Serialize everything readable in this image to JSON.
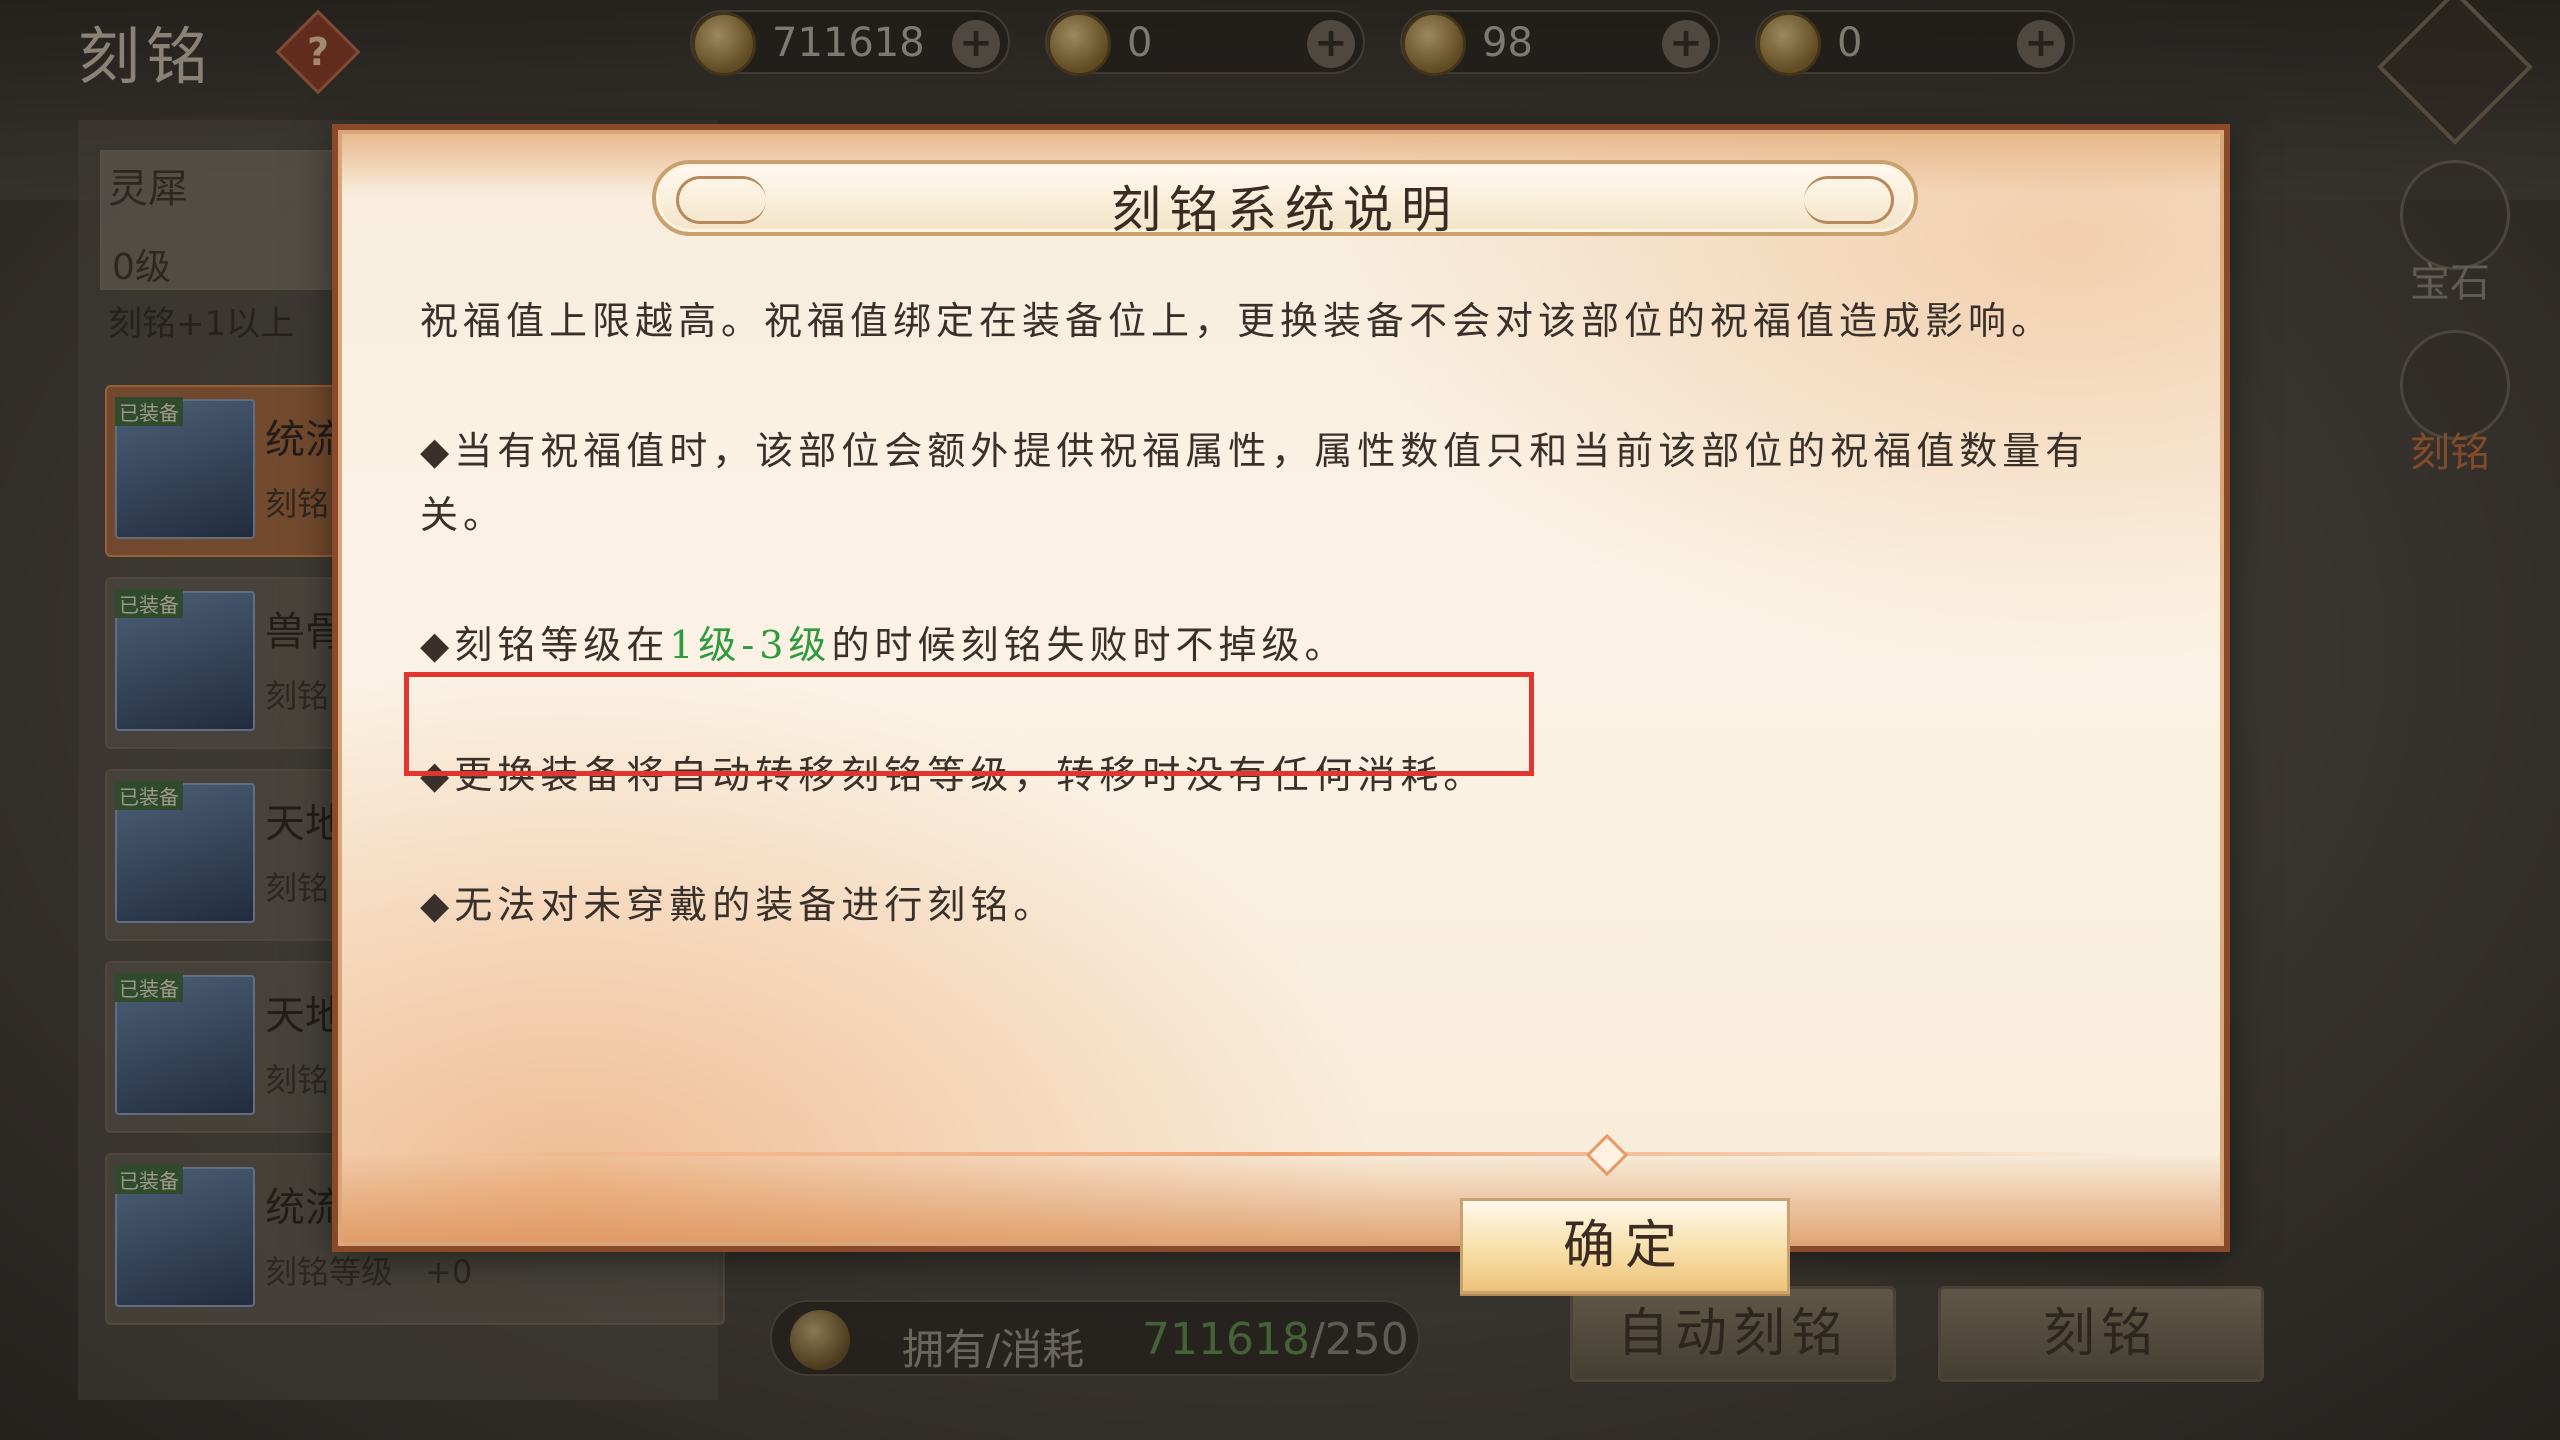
{
  "page": {
    "title": "刻铭",
    "help": "?"
  },
  "currencies": [
    {
      "amount": "711618"
    },
    {
      "amount": "0"
    },
    {
      "amount": "98"
    },
    {
      "amount": "0"
    }
  ],
  "rank": {
    "name": "灵犀",
    "level": "0级",
    "hint": "刻铭+1以上"
  },
  "equipment": [
    {
      "tag": "已装备",
      "name": "统流",
      "sub": "刻铭"
    },
    {
      "tag": "已装备",
      "name": "兽骨",
      "sub": "刻铭"
    },
    {
      "tag": "已装备",
      "name": "天地",
      "sub": "刻铭"
    },
    {
      "tag": "已装备",
      "name": "天地",
      "sub": "刻铭"
    },
    {
      "tag": "已装备",
      "name": "统流",
      "sub": "刻铭等级　+0"
    }
  ],
  "side_nav": [
    {
      "label": "宝石"
    },
    {
      "label": "刻铭"
    }
  ],
  "bottom": {
    "label": "拥有/消耗",
    "owned": "711618",
    "cost": "/250",
    "auto_btn": "自动刻铭",
    "engrave_btn": "刻铭"
  },
  "modal": {
    "title": "刻铭系统说明",
    "p0": "祝福值上限越高。祝福值绑定在装备位上，更换装备不会对该部位的祝福值造成影响。",
    "p1": "◆当有祝福值时，该部位会额外提供祝福属性，属性数值只和当前该部位的祝福值数量有关。",
    "p2_pre": "◆刻铭等级在",
    "p2_hl": "1级-3级",
    "p2_post": "的时候刻铭失败时不掉级。",
    "p3": "◆更换装备将自动转移刻铭等级，转移时没有任何消耗。",
    "p4": "◆无法对未穿戴的装备进行刻铭。",
    "confirm": "确定"
  },
  "colors": {
    "highlight_green": "#2f9a3e",
    "annotation_red": "#e2352f",
    "panel_bg": "#fbf3e6"
  }
}
